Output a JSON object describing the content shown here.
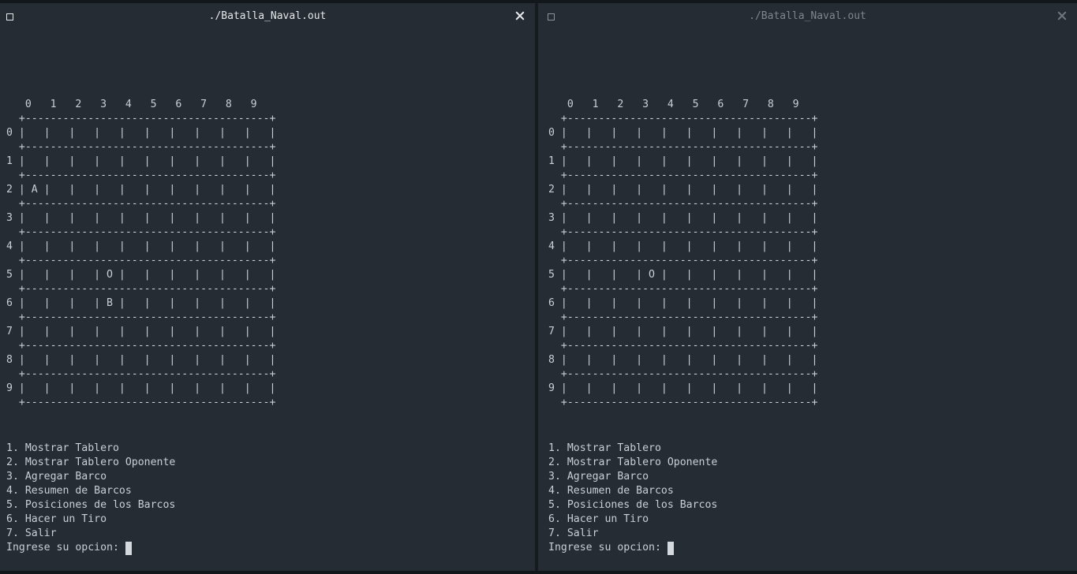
{
  "windows": [
    {
      "title": "./Batalla_Naval.out",
      "board": {
        "header": "   0   1   2   3   4   5   6   7   8   9",
        "separator": "  +---------------------------------------+",
        "rows": [
          "0 |   |   |   |   |   |   |   |   |   |   |",
          "1 |   |   |   |   |   |   |   |   |   |   |",
          "2 | A |   |   |   |   |   |   |   |   |   |",
          "3 |   |   |   |   |   |   |   |   |   |   |",
          "4 |   |   |   |   |   |   |   |   |   |   |",
          "5 |   |   |   | O |   |   |   |   |   |   |",
          "6 |   |   |   | B |   |   |   |   |   |   |",
          "7 |   |   |   |   |   |   |   |   |   |   |",
          "8 |   |   |   |   |   |   |   |   |   |   |",
          "9 |   |   |   |   |   |   |   |   |   |   |"
        ]
      },
      "menu": [
        "1. Mostrar Tablero",
        "2. Mostrar Tablero Oponente",
        "3. Agregar Barco",
        "4. Resumen de Barcos",
        "5. Posiciones de los Barcos",
        "6. Hacer un Tiro",
        "7. Salir"
      ],
      "prompt": "Ingrese su opcion: "
    },
    {
      "title": "./Batalla_Naval.out",
      "board": {
        "header": "   0   1   2   3   4   5   6   7   8   9",
        "separator": "  +---------------------------------------+",
        "rows": [
          "0 |   |   |   |   |   |   |   |   |   |   |",
          "1 |   |   |   |   |   |   |   |   |   |   |",
          "2 |   |   |   |   |   |   |   |   |   |   |",
          "3 |   |   |   |   |   |   |   |   |   |   |",
          "4 |   |   |   |   |   |   |   |   |   |   |",
          "5 |   |   |   | O |   |   |   |   |   |   |",
          "6 |   |   |   |   |   |   |   |   |   |   |",
          "7 |   |   |   |   |   |   |   |   |   |   |",
          "8 |   |   |   |   |   |   |   |   |   |   |",
          "9 |   |   |   |   |   |   |   |   |   |   |"
        ]
      },
      "menu": [
        "1. Mostrar Tablero",
        "2. Mostrar Tablero Oponente",
        "3. Agregar Barco",
        "4. Resumen de Barcos",
        "5. Posiciones de los Barcos",
        "6. Hacer un Tiro",
        "7. Salir"
      ],
      "prompt": "Ingrese su opcion: "
    }
  ],
  "icons": {
    "window_icon": "square-window-icon",
    "close_icon": "close-icon"
  },
  "colors": {
    "background": "#252c33",
    "text": "#c8cfd6",
    "cursor": "#d4d9de"
  }
}
